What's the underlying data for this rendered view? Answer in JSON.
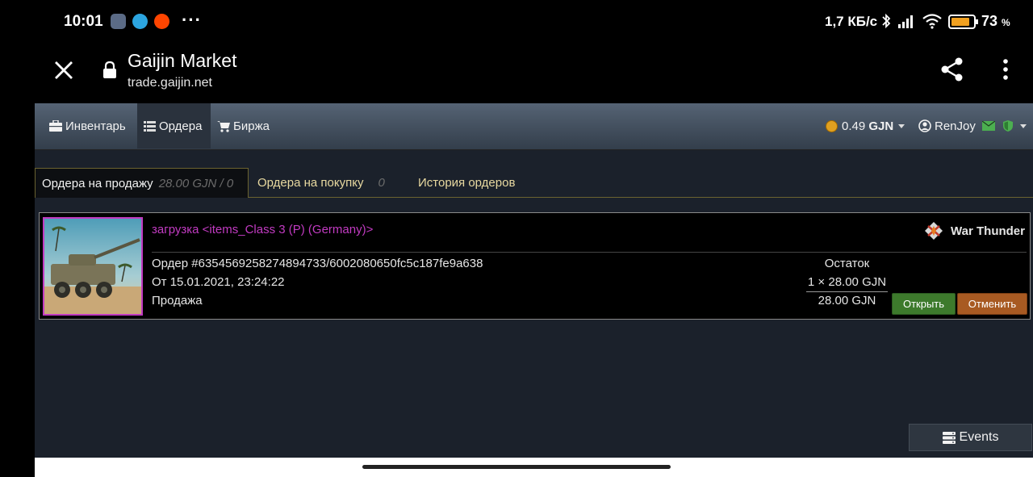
{
  "status": {
    "time": "10:01",
    "speed": "1,7 КБ/с",
    "battery": "73",
    "battery_unit": "%",
    "dots": "···"
  },
  "browser": {
    "title": "Gaijin Market",
    "url": "trade.gaijin.net"
  },
  "nav": {
    "inventory": "Инвентарь",
    "orders": "Ордера",
    "exchange": "Биржа",
    "balance": "0.49",
    "currency": "GJN",
    "username": "RenJoy"
  },
  "tabs": {
    "sell": "Ордера на продажу",
    "sell_meta": "28.00 GJN / 0",
    "buy": "Ордера на покупку",
    "buy_meta": "0",
    "history": "История ордеров"
  },
  "order": {
    "item_name": "загрузка <items_Class 3 (P) (Germany)>",
    "game": "War Thunder",
    "order_id": "Ордер #6354569258274894733/6002080650fc5c187fe9a638",
    "date": "От 15.01.2021, 23:24:22",
    "type": "Продажа",
    "remain_label": "Остаток",
    "remain_qty": "1 × 28.00 GJN",
    "remain_total": "28.00 GJN",
    "open_label": "Открыть",
    "cancel_label": "Отменить"
  },
  "events_label": "Events",
  "colors": {
    "item_name": "#c23bc2",
    "open_button": "#3d7a2c",
    "cancel_button": "#a85a22",
    "tab_text": "#e8d9a0"
  }
}
